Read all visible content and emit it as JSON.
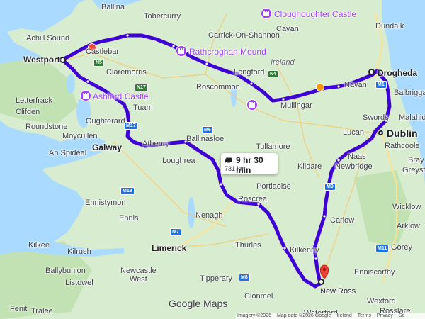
{
  "route": {
    "duration": "9 hr 30 min",
    "distance": "731 km",
    "color": "#3f00d6"
  },
  "cities": {
    "westport": "Westport",
    "galway": "Galway",
    "drogheda": "Drogheda",
    "dublin": "Dublin",
    "new_ross": "New Ross",
    "limerick": "Limerick"
  },
  "towns": {
    "ballina": "Ballina",
    "tobercurry": "Tobercurry",
    "achill_sound": "Achill Sound",
    "castlebar": "Castlebar",
    "carrick": "Carrick-On-Shannon",
    "cavan": "Cavan",
    "dundalk": "Dundalk",
    "claremorris": "Claremorris",
    "longford": "Longford",
    "navan": "Navan",
    "balbriggan": "Balbriggan",
    "letterfrack": "Letterfrack",
    "clifden": "Clifden",
    "roscommon": "Roscommon",
    "mullingar": "Mullingar",
    "tuam": "Tuam",
    "swords": "Swords",
    "malahide": "Malahide",
    "roundstone": "Roundstone",
    "moycullen": "Moycullen",
    "oughterard": "Oughterard",
    "ballinasloe": "Ballinasloe",
    "lucan": "Lucan",
    "tullamore": "Tullamore",
    "rathcoole": "Rathcoole",
    "an_spideal": "An Spidéal",
    "athenry": "Athenry",
    "loughrea": "Loughrea",
    "naas": "Naas",
    "kildare": "Kildare",
    "newbridge": "Newbridge",
    "bray": "Bray",
    "greystones": "Greysto",
    "portlaoise": "Portlaoise",
    "ennistymon": "Ennistymon",
    "roscrea": "Roscrea",
    "ennis": "Ennis",
    "wicklow": "Wicklow",
    "nenagh": "Nenagh",
    "carlow": "Carlow",
    "kilkee": "Kilkee",
    "arklow": "Arklow",
    "kilrush": "Kilrush",
    "thurles": "Thurles",
    "kilkenny": "Kilkenny",
    "gorey": "Gorey",
    "ballybunion": "Ballybunion",
    "tipperary": "Tipperary",
    "enniscorthy": "Enniscorthy",
    "listowel": "Listowel",
    "newcastle_west": "Newcastle\nWest",
    "clonmel": "Clonmel",
    "wexford": "Wexford",
    "fenit": "Fenit",
    "tralee": "Tralee",
    "waterford": "Waterford",
    "rosslare": "Rosslare"
  },
  "country_label": "Ireland",
  "pois": {
    "cloughoughter": "Cloughoughter Castle",
    "rathcroghan": "Rathcroghan Mound",
    "ashford": "Ashford Castle"
  },
  "road_shields": [
    "N5",
    "N4",
    "M6",
    "M18",
    "M7",
    "M9",
    "M1",
    "M11",
    "M17",
    "N17",
    "M8"
  ],
  "logo": "Google Maps",
  "attribution": [
    "Imagery ©2026",
    "Map data ©2026 Google",
    "Ireland",
    "Terms",
    "Privacy",
    "Se"
  ],
  "colors": {
    "sea": "#aadaff",
    "land": "#d8ecd0",
    "land_dark": "#c3e2b4",
    "poi": "#a142f4",
    "pin": "#ea4335"
  }
}
